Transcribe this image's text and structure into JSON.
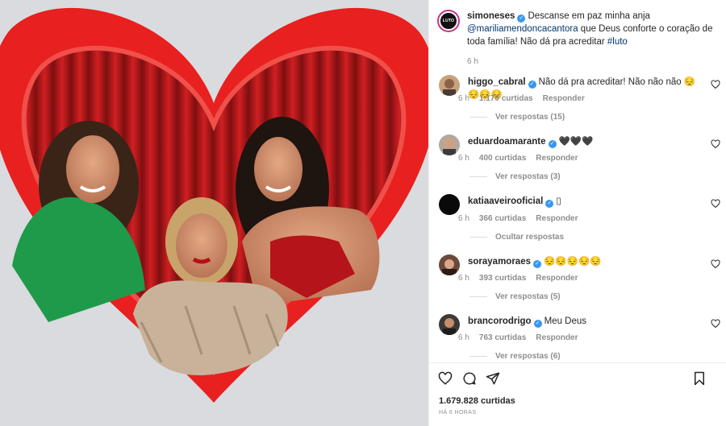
{
  "caption": {
    "username": "simoneses",
    "avatar_label": "LUTO",
    "text_1": "Descanse em paz minha anja",
    "mention": "@mariliamendoncacantora",
    "text_2": " que Deus conforte o coração de toda família! Não dá pra acreditar ",
    "hashtag": "#luto",
    "time": "6 h"
  },
  "comments": [
    {
      "username": "higgo_cabral",
      "text": "Não dá pra acreditar! Não não não 😔😔😔😔",
      "time": "6 h",
      "likes": "1.170 curtidas",
      "reply": "Responder",
      "replies": "Ver respostas (15)"
    },
    {
      "username": "eduardoamarante",
      "text": "🖤🖤🖤",
      "time": "6 h",
      "likes": "400 curtidas",
      "reply": "Responder",
      "replies": "Ver respostas (3)"
    },
    {
      "username": "katiaaveirooficial",
      "text": "▯",
      "time": "6 h",
      "likes": "366 curtidas",
      "reply": "Responder",
      "replies": "Ocultar respostas"
    },
    {
      "username": "sorayamoraes",
      "text": "😔😔😔😔😔",
      "time": "6 h",
      "likes": "393 curtidas",
      "reply": "Responder",
      "replies": "Ver respostas (5)"
    },
    {
      "username": "brancorodrigo",
      "text": "Meu Deus",
      "time": "6 h",
      "likes": "763 curtidas",
      "reply": "Responder",
      "replies": "Ver respostas (6)"
    }
  ],
  "footer": {
    "likes": "1.679.828 curtidas",
    "time": "HÁ 6 HORAS"
  },
  "icons": {
    "like": "heart-outline-icon",
    "comment": "speech-bubble-icon",
    "share": "paper-plane-icon",
    "save": "bookmark-icon"
  },
  "colors": {
    "heart_frame": "#e8201f",
    "verified": "#3897f0",
    "link": "#00376b"
  }
}
